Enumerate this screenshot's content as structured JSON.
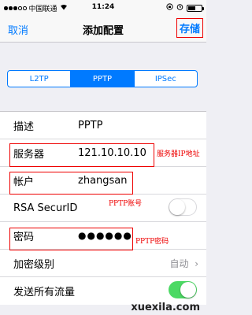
{
  "status_bar": {
    "carrier": "中国联通",
    "time": "11:24",
    "battery_level": 0.55
  },
  "nav": {
    "cancel_label": "取消",
    "title": "添加配置",
    "save_label": "存储"
  },
  "segments": [
    {
      "label": "L2TP",
      "active": false
    },
    {
      "label": "PPTP",
      "active": true
    },
    {
      "label": "IPSec",
      "active": false
    }
  ],
  "form": {
    "description": {
      "label": "描述",
      "value": "PPTP"
    },
    "server": {
      "label": "服务器",
      "value": "121.10.10.10"
    },
    "account": {
      "label": "帐户",
      "value": "zhangsan"
    },
    "rsa": {
      "label": "RSA SecurID",
      "enabled": false
    },
    "password": {
      "label": "密码",
      "value": "●●●●●●"
    },
    "encryption": {
      "label": "加密级别",
      "value": "自动"
    },
    "send_all": {
      "label": "发送所有流量",
      "enabled": true
    }
  },
  "annotations": {
    "server": "服务器IP地址",
    "account": "PPTP账号",
    "password": "PPTP密码"
  },
  "watermark": "xuexila.com",
  "colors": {
    "accent": "#007aff",
    "annotation": "#e00000",
    "toggle_on": "#4cd964"
  }
}
